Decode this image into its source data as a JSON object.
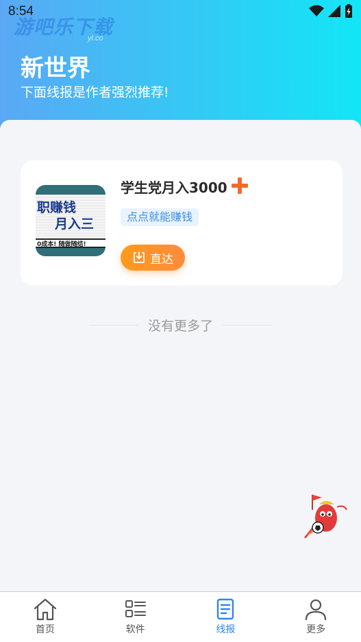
{
  "status_bar": {
    "time": "8:54"
  },
  "watermark": {
    "text": "游吧乐下载",
    "sub": "yl.co"
  },
  "header": {
    "title": "新世界",
    "subtitle": "下面线报是作者强烈推荐!"
  },
  "card": {
    "thumbnail": {
      "line1": "职赚钱",
      "line2": "月入三",
      "strip": "0成本! 随做随结!"
    },
    "title": "学生党月入3000",
    "tag": "点点就能赚钱",
    "button_label": "直达"
  },
  "list_footer": "没有更多了",
  "tabbar": {
    "items": [
      {
        "label": "首页",
        "icon": "home-icon",
        "active": false
      },
      {
        "label": "软件",
        "icon": "apps-list-icon",
        "active": false
      },
      {
        "label": "线报",
        "icon": "document-icon",
        "active": true
      },
      {
        "label": "更多",
        "icon": "user-icon",
        "active": false
      }
    ]
  },
  "colors": {
    "accent": "#2e86ea",
    "button": "#ff9a1a",
    "plus": "#f26a2e",
    "tag_bg": "#e9f3fd",
    "tag_text": "#3e8fe0"
  }
}
